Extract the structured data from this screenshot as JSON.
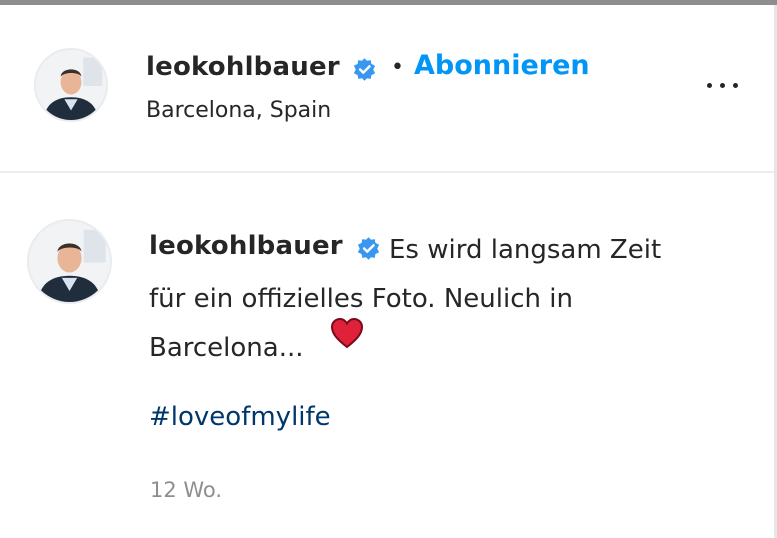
{
  "header": {
    "username": "leokohlbauer",
    "separator": "•",
    "follow_label": "Abonnieren",
    "location": "Barcelona, Spain"
  },
  "comment": {
    "username": "leokohlbauer",
    "text_line1": "Es wird langsam Zeit",
    "text_line2": "für ein offizielles Foto. Neulich in",
    "text_line3": "Barcelona...",
    "emoji": "❤",
    "hashtag": "#loveofmylife",
    "timestamp": "12 Wo."
  },
  "icons": {
    "verified": "verified-badge-icon",
    "more": "more-options-icon",
    "heart": "red-heart-emoji"
  },
  "colors": {
    "link_blue": "#0095f6",
    "hashtag_blue": "#00376b",
    "verified_blue": "#3897f0",
    "heart_red": "#e0213a",
    "muted_gray": "#8e8e8e"
  }
}
